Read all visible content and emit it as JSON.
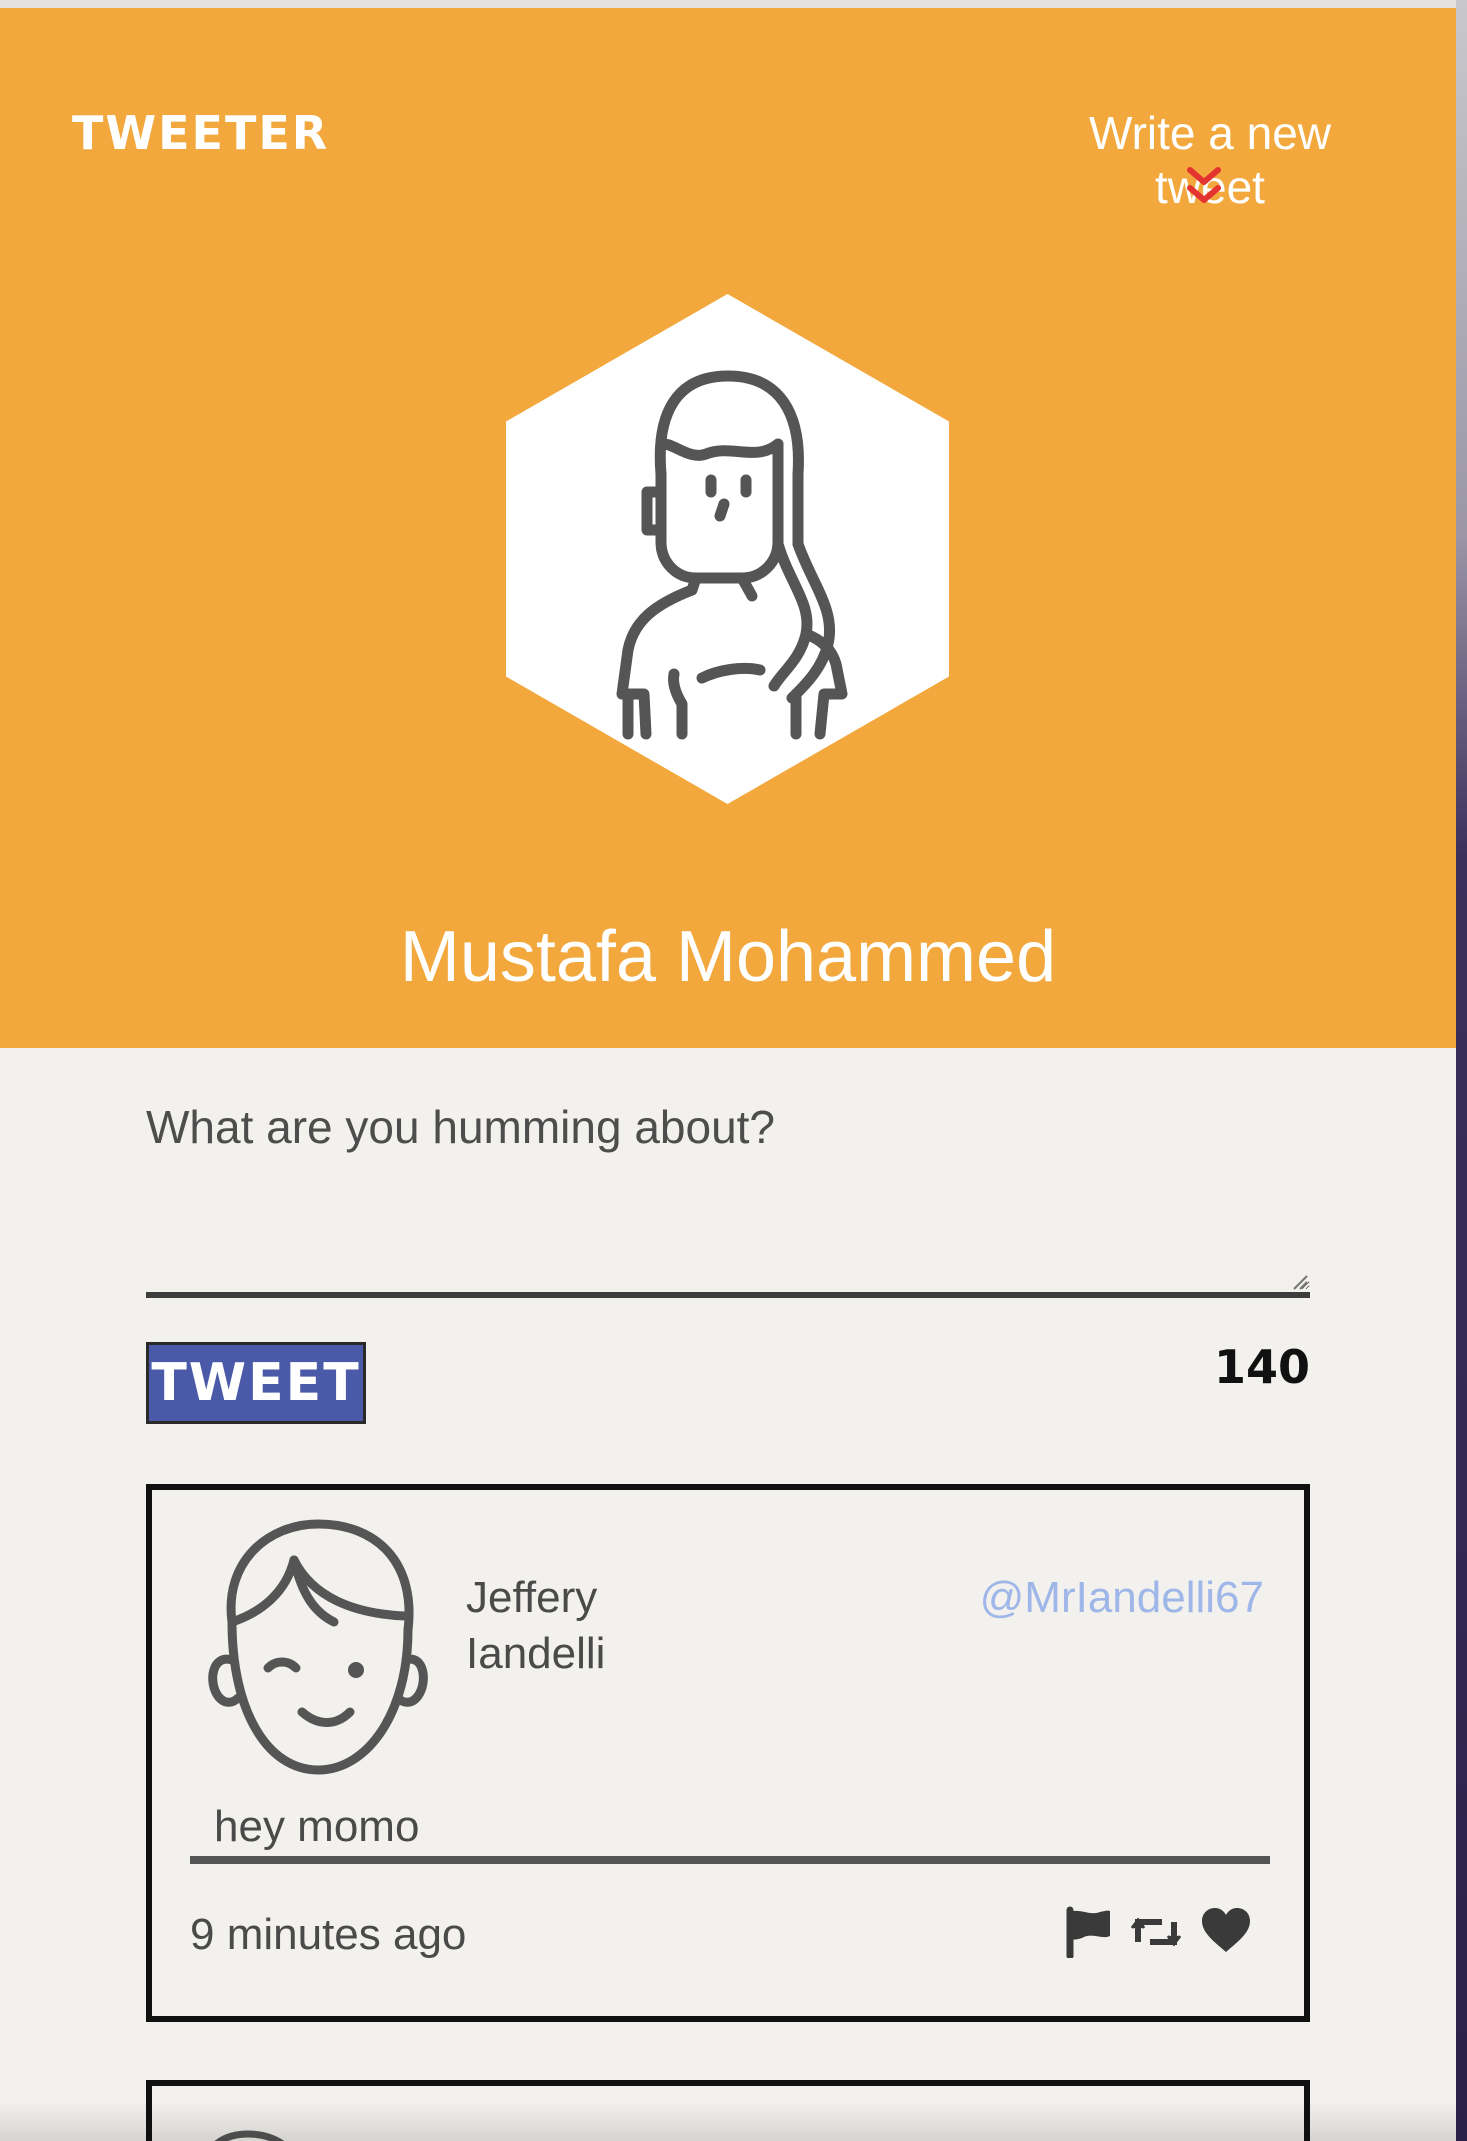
{
  "app": {
    "brand": "TWEETER",
    "compose_toggle_label": "Write a new tweet",
    "compose_toggle_icon": "chevron-double-down-icon",
    "profile_avatar_icon": "woman-avatar-icon"
  },
  "profile": {
    "name": "Mustafa Mohammed"
  },
  "composer": {
    "placeholder": "What are you humming about?",
    "value": "",
    "submit_label": "TWEET",
    "char_counter": "140"
  },
  "tweets": [
    {
      "author_name": "Jeffery Iandelli",
      "handle": "@MrIandelli67",
      "text": "hey momo",
      "timestamp": "9 minutes ago",
      "avatar_icon": "man-avatar-icon",
      "actions": [
        "flag-icon",
        "retweet-icon",
        "heart-icon"
      ]
    }
  ],
  "colors": {
    "header_bg": "#f2a83d",
    "page_bg": "#f2f1ed",
    "tweet_button_bg": "#4a5aa8",
    "handle_color": "#9fb6e8",
    "chevron_color": "#e3342f"
  }
}
